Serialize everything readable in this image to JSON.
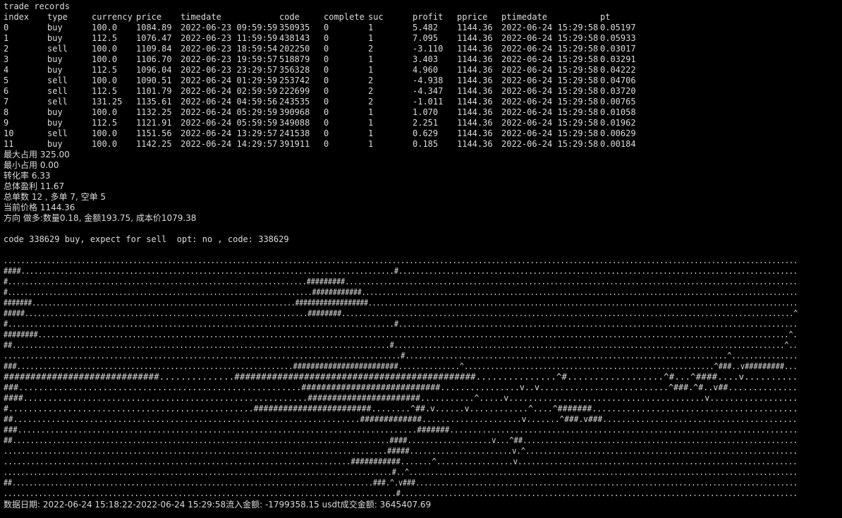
{
  "terminal": {
    "title_line": "trade records",
    "table": {
      "headers": [
        "index",
        "type",
        "currency",
        "price",
        "timedate",
        "code",
        "complete",
        "suc",
        "profit",
        "pprice",
        "ptimedate",
        "pt"
      ],
      "rows": [
        [
          "0",
          "buy",
          "100.0",
          "1084.89",
          "2022-06-23 09:59:59",
          "350935",
          "0",
          "1",
          "5.482",
          "1144.36",
          "2022-06-24 15:29:58",
          "0.05197"
        ],
        [
          "1",
          "buy",
          "112.5",
          "1076.47",
          "2022-06-23 11:59:59",
          "438143",
          "0",
          "1",
          "7.095",
          "1144.36",
          "2022-06-24 15:29:58",
          "0.05933"
        ],
        [
          "2",
          "sell",
          "100.0",
          "1109.84",
          "2022-06-23 18:59:54",
          "202250",
          "0",
          "2",
          "-3.110",
          "1144.36",
          "2022-06-24 15:29:58",
          "0.03017"
        ],
        [
          "3",
          "buy",
          "100.0",
          "1106.70",
          "2022-06-23 19:59:57",
          "518879",
          "0",
          "1",
          "3.403",
          "1144.36",
          "2022-06-24 15:29:58",
          "0.03291"
        ],
        [
          "4",
          "buy",
          "112.5",
          "1096.04",
          "2022-06-23 23:29:57",
          "356328",
          "0",
          "1",
          "4.960",
          "1144.36",
          "2022-06-24 15:29:58",
          "0.04222"
        ],
        [
          "5",
          "sell",
          "100.0",
          "1090.51",
          "2022-06-24 01:29:59",
          "253742",
          "0",
          "2",
          "-4.938",
          "1144.36",
          "2022-06-24 15:29:58",
          "0.04706"
        ],
        [
          "6",
          "sell",
          "112.5",
          "1101.79",
          "2022-06-24 02:59:59",
          "222699",
          "0",
          "2",
          "-4.347",
          "1144.36",
          "2022-06-24 15:29:58",
          "0.03720"
        ],
        [
          "7",
          "sell",
          "131.25",
          "1135.61",
          "2022-06-24 04:59:56",
          "243535",
          "0",
          "2",
          "-1.011",
          "1144.36",
          "2022-06-24 15:29:58",
          "0.00765"
        ],
        [
          "8",
          "buy",
          "100.0",
          "1132.25",
          "2022-06-24 05:29:59",
          "390968",
          "0",
          "1",
          "1.070",
          "1144.36",
          "2022-06-24 15:29:58",
          "0.01058"
        ],
        [
          "9",
          "buy",
          "112.5",
          "1121.91",
          "2022-06-24 05:59:59",
          "349088",
          "0",
          "1",
          "2.251",
          "1144.36",
          "2022-06-24 15:29:58",
          "0.01962"
        ],
        [
          "10",
          "sell",
          "100.0",
          "1151.56",
          "2022-06-24 13:29:57",
          "241538",
          "0",
          "1",
          "0.629",
          "1144.36",
          "2022-06-24 15:29:58",
          "0.00629"
        ],
        [
          "11",
          "buy",
          "100.0",
          "1142.25",
          "2022-06-24 14:29:57",
          "391911",
          "0",
          "1",
          "0.185",
          "1144.36",
          "2022-06-24 15:29:58",
          "0.00184"
        ]
      ]
    },
    "summary": [
      "最大占用 325.00",
      "最小占用 0.00",
      "转化率 6.33",
      "总体盈利 11.67",
      "总单数 12 , 多单 7, 空单 5",
      "当前价格 1144.36",
      "方向 做多:数量0.18, 金额193.75, 成本价1079.38"
    ],
    "code_line": "code 338629 buy, expect for sell  opt: no , code: 338629",
    "plot_lines": [
      "........................................................................................................................................................................................",
      "####......................................................................................#............................................................................................",
      "#......................................................................#########..........................................................................................................",
      "#..........................................................................############..........................................................................................................",
      "#######.................................................................##################..........................................................................................................",
      "#####...................................................................########...........................................................................................................^",
      "#.........................................................................................#............................................................................................",
      "########...............................................................................................................................................................................^.",
      "##........................................................................................#...........................................................................................^..",
      "..........................................................................................#.........................................................................^...............",
      "###...............................................................########################..............^.........................................................^###..v#########...",
      "#############################..............#############################################...............^#..................^#...^####....v..........",
      "###.........................................................############################................v..v..........................^###.^#..v##..............",
      "####..........................................................#######################...........^.....v........................................v..................",
      "#..................................................########################........^##.v......v............^....^#######..........................................",
      "##.........................................................................#############.....................v.......^###.v###.........................................",
      "###......................................................................................#######...........................................................................",
      "##.....................................................................................####...................v...^##..............................................................",
      "......................................................................................#####.......................v.^.............................................................",
      ".............................................................................###########.......^.................v..............................................................",
      "...........................................................................................#..^...........................................................................................",
      "##.....................................................................................###.^.v###..........................................................................................",
      "..........................................................................................#..........................................................................................."
    ],
    "footer_line": "数据日期: 2022-06-24 15:18:22-2022-06-24 15:29:58流入金额: -1799358.15 usdt成交金额: 3645407.69"
  }
}
